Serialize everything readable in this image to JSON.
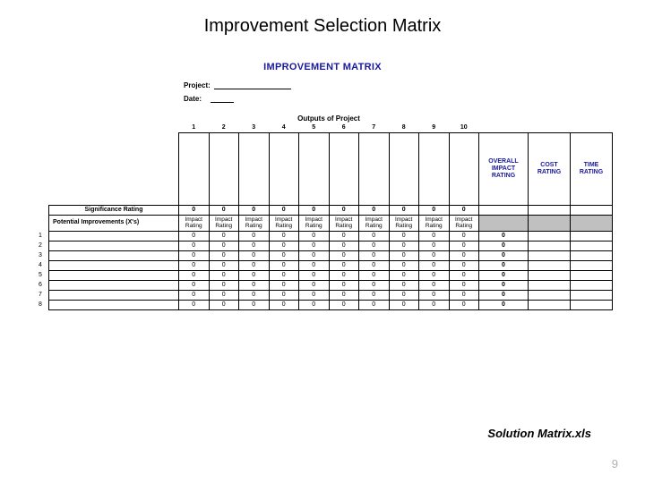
{
  "title": "Improvement Selection Matrix",
  "matrix_title": "IMPROVEMENT MATRIX",
  "meta": {
    "project_label": "Project:",
    "date_label": "Date:"
  },
  "outputs_header": "Outputs of Project",
  "col_numbers": [
    "1",
    "2",
    "3",
    "4",
    "5",
    "6",
    "7",
    "8",
    "9",
    "10"
  ],
  "right_headers": {
    "overall": "OVERALL IMPACT RATING",
    "cost": "COST RATING",
    "time": "TIME RATING"
  },
  "significance_label": "Significance Rating",
  "potential_label": "Potential Improvements (X's)",
  "impact_rating_label": "Impact Rating",
  "sig_values": [
    "0",
    "0",
    "0",
    "0",
    "0",
    "0",
    "0",
    "0",
    "0",
    "0"
  ],
  "row_numbers": [
    "1",
    "2",
    "3",
    "4",
    "5",
    "6",
    "7",
    "8"
  ],
  "cell_values": [
    [
      "0",
      "0",
      "0",
      "0",
      "0",
      "0",
      "0",
      "0",
      "0",
      "0",
      "0"
    ],
    [
      "0",
      "0",
      "0",
      "0",
      "0",
      "0",
      "0",
      "0",
      "0",
      "0",
      "0"
    ],
    [
      "0",
      "0",
      "0",
      "0",
      "0",
      "0",
      "0",
      "0",
      "0",
      "0",
      "0"
    ],
    [
      "0",
      "0",
      "0",
      "0",
      "0",
      "0",
      "0",
      "0",
      "0",
      "0",
      "0"
    ],
    [
      "0",
      "0",
      "0",
      "0",
      "0",
      "0",
      "0",
      "0",
      "0",
      "0",
      "0"
    ],
    [
      "0",
      "0",
      "0",
      "0",
      "0",
      "0",
      "0",
      "0",
      "0",
      "0",
      "0"
    ],
    [
      "0",
      "0",
      "0",
      "0",
      "0",
      "0",
      "0",
      "0",
      "0",
      "0",
      "0"
    ],
    [
      "0",
      "0",
      "0",
      "0",
      "0",
      "0",
      "0",
      "0",
      "0",
      "0",
      "0"
    ]
  ],
  "footer": {
    "filename": "Solution Matrix.xls",
    "page": "9"
  }
}
